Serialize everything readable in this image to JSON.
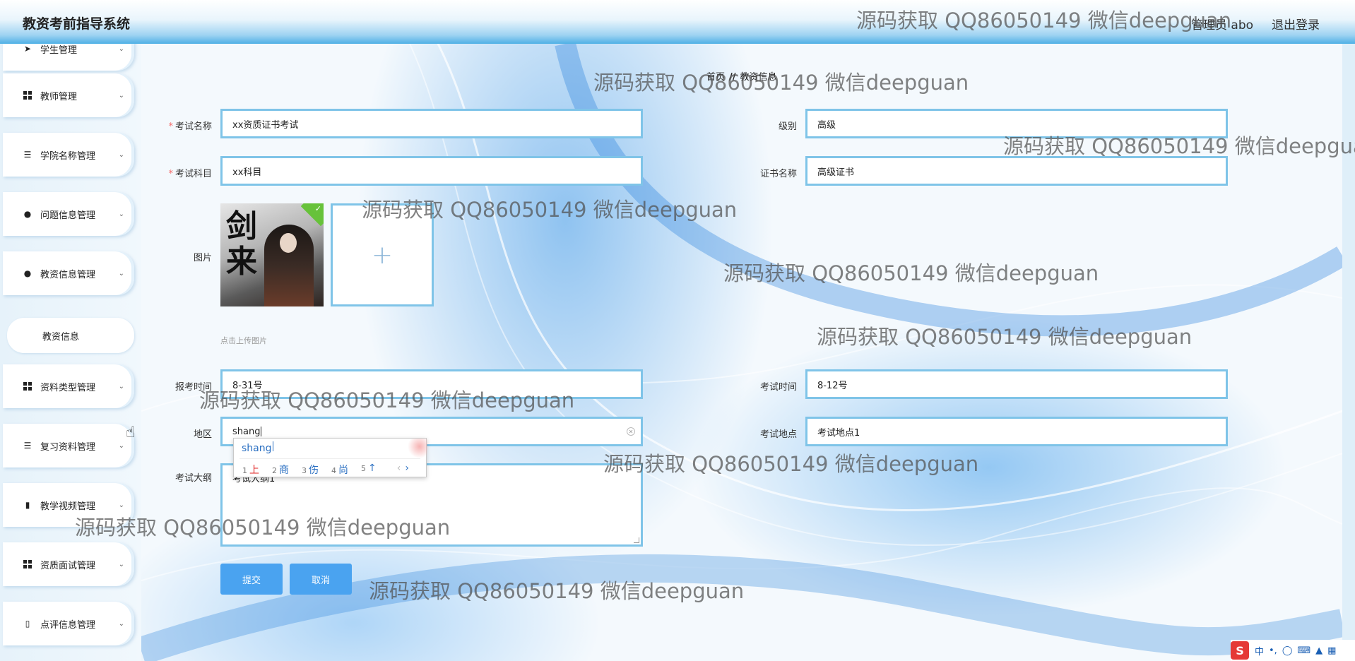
{
  "app": {
    "title": "教资考前指导系统",
    "user_label": "管理员 abo",
    "logout_label": "退出登录"
  },
  "sidebar": {
    "items": [
      {
        "label": "学生管理",
        "icon": "send-icon"
      },
      {
        "label": "教师管理",
        "icon": "grid-icon"
      },
      {
        "label": "学院名称管理",
        "icon": "sliders-icon"
      },
      {
        "label": "问题信息管理",
        "icon": "user-icon"
      },
      {
        "label": "教资信息管理",
        "icon": "user-icon"
      },
      {
        "label": "资料类型管理",
        "icon": "grid-icon"
      },
      {
        "label": "复习资料管理",
        "icon": "list-icon"
      },
      {
        "label": "教学视频管理",
        "icon": "bar-chart-icon"
      },
      {
        "label": "资质面试管理",
        "icon": "grid-icon"
      },
      {
        "label": "点评信息管理",
        "icon": "books-icon"
      }
    ],
    "submenu_label": "教资信息"
  },
  "breadcrumb": {
    "home": "首页",
    "separator": "//",
    "current": "教资信息"
  },
  "form": {
    "exam_name_label": "考试名称",
    "exam_name_value": "xx资质证书考试",
    "level_label": "级别",
    "level_value": "高级",
    "subject_label": "考试科目",
    "subject_value": "xx科目",
    "certificate_label": "证书名称",
    "certificate_value": "高级证书",
    "image_label": "图片",
    "upload_plus": "+",
    "upload_tip": "点击上传图片",
    "register_time_label": "报考时间",
    "register_time_value": "8-31号",
    "exam_time_label": "考试时间",
    "exam_time_value": "8-12号",
    "region_label": "地区",
    "region_value": "shang",
    "location_label": "考试地点",
    "location_value": "考试地点1",
    "outline_label": "考试大纲",
    "outline_value": "考试大纲1",
    "submit_label": "提交",
    "cancel_label": "取消",
    "required_mark": "*"
  },
  "ime": {
    "composition": "shang",
    "candidates": [
      {
        "num": "1",
        "text": "上"
      },
      {
        "num": "2",
        "text": "商"
      },
      {
        "num": "3",
        "text": "伤"
      },
      {
        "num": "4",
        "text": "尚"
      },
      {
        "num": "5",
        "text": "↑"
      }
    ],
    "prev": "‹",
    "next": "›"
  },
  "watermark": {
    "text": "源码获取 QQ86050149 微信deepguan"
  },
  "tray": {
    "logo": "S",
    "mode": "中",
    "punct": "•,"
  },
  "colors": {
    "accent": "#4aa3f0",
    "input_border": "#7fc4e8",
    "required": "#f56c6c"
  }
}
